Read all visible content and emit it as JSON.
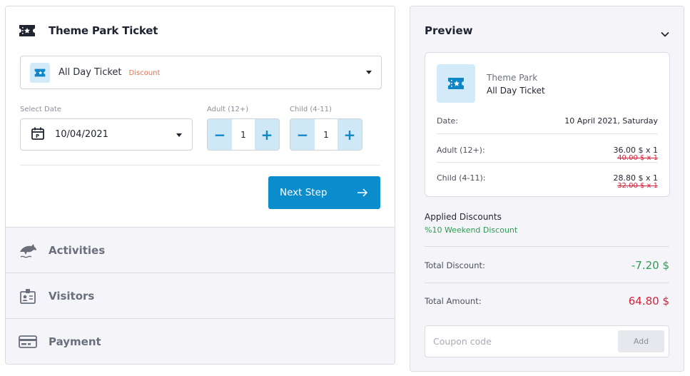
{
  "ticket_section": {
    "title": "Theme Park Ticket",
    "ticket_select": {
      "name": "All Day Ticket",
      "badge": "Discount"
    },
    "date": {
      "label": "Select Date",
      "value": "10/04/2021"
    },
    "adult": {
      "label": "Adult (12+)",
      "count": "1",
      "minus": "−",
      "plus": "+"
    },
    "child": {
      "label": "Child (4-11)",
      "count": "1",
      "minus": "−",
      "plus": "+"
    },
    "next_button": "Next Step"
  },
  "steps": [
    {
      "label": "Activities",
      "icon": "dolphin-icon"
    },
    {
      "label": "Visitors",
      "icon": "id-card-icon"
    },
    {
      "label": "Payment",
      "icon": "credit-card-icon"
    }
  ],
  "preview": {
    "title": "Preview",
    "park": "Theme Park",
    "ticket": "All Day Ticket",
    "date_label": "Date:",
    "date_value": "10 April 2021, Saturday",
    "adult_label": "Adult (12+):",
    "adult_price": "36.00 $ x 1",
    "adult_old": "40.00 $ x 1",
    "child_label": "Child (4-11):",
    "child_price": "28.80 $ x 1",
    "child_old": "32.00 $ x 1",
    "applied_label": "Applied Discounts",
    "applied_value": "%10 Weekend Discount",
    "total_discount_label": "Total Discount:",
    "total_discount_value": "-7.20 $",
    "total_amount_label": "Total Amount:",
    "total_amount_value": "64.80 $",
    "coupon_placeholder": "Coupon code",
    "coupon_button": "Add"
  },
  "colors": {
    "accent": "#0b8ccd",
    "discount_green": "#2e9a54",
    "amount_red": "#d0263b",
    "badge_orange": "#e2704b"
  }
}
